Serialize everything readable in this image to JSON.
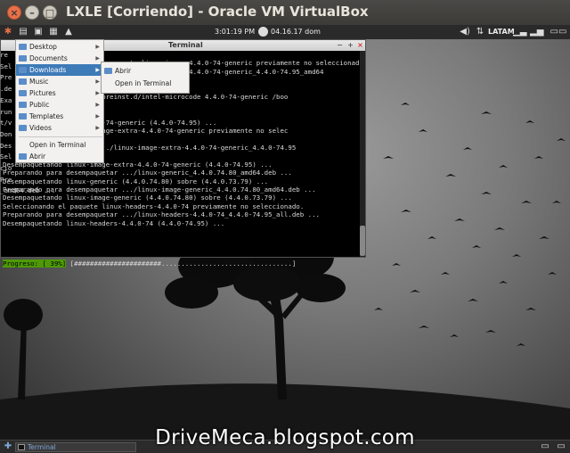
{
  "host_window": {
    "title": "LXLE [Corriendo] - Oracle VM VirtualBox",
    "controls": [
      "×",
      "–",
      "□"
    ]
  },
  "top_panel": {
    "clock": "3:01:19 PM",
    "date": "04.16.17 dom",
    "keyboard_layout": "LATAM",
    "icons": [
      "menu-icon",
      "files-icon",
      "monitor-icon",
      "apps-icon",
      "up-arrow-icon",
      "volume-icon",
      "network-icon",
      "updates-icon",
      "signal-icon",
      "power-icon"
    ]
  },
  "terminal": {
    "title": "Terminal",
    "controls": [
      "−",
      "+",
      "×"
    ],
    "left_glyphs": [
      "re",
      "Sel",
      "Pre",
      ".de",
      "Exa",
      "run",
      "t/v",
      "Don",
      "Des",
      "Sel",
      "cio",
      "Pre",
      "_amd64.deb ..."
    ],
    "lines": [
      "               04.1) ...",
      "          Seleccionando el paquete linux-image-4.4.0-74-generic previamente no seleccionad",
      "               a desempaquetar .../linux-image-4.4.0-74-generic_4.4.0-74.95_amd64",
      "",
      "               reinst.d/",
      "               tc/kernel/preinst.d/intel-microcode 4.4.0-74-generic /boo",
      "               ric",
      "",
      "               mage-4.4.0-74-generic (4.4.0-74.95) ...",
      "               e linux-image-extra-4.4.0-74-generic previamente no selec",
      "",
      "               paquetar .../linux-image-extra-4.4.0-74-generic_4.4.0-74.95",
      "",
      "Desempaquetando linux-image-extra-4.4.0-74-generic (4.4.0-74.95) ...",
      "Preparando para desempaquetar .../linux-generic_4.4.0.74.80_amd64.deb ...",
      "Desempaquetando linux-generic (4.4.0.74.80) sobre (4.4.0.73.79) ...",
      "Preparando para desempaquetar .../linux-image-generic_4.4.0.74.80_amd64.deb ...",
      "Desempaquetando linux-image-generic (4.4.0.74.80) sobre (4.4.0.73.79) ...",
      "Seleccionando el paquete linux-headers-4.4.0-74 previamente no seleccionado.",
      "Preparando para desempaquetar .../linux-headers-4.4.0-74_4.4.0-74.95_all.deb ...",
      "Desempaquetando linux-headers-4.4.0-74 (4.4.0-74.95) ..."
    ],
    "progress_label": "Progreso: [ 39%]",
    "progress_bar": " [######################.................................]",
    "progress_percent": 39
  },
  "places_menu": {
    "items": [
      {
        "label": "Desktop",
        "has_submenu": true
      },
      {
        "label": "Documents",
        "has_submenu": true
      },
      {
        "label": "Downloads",
        "has_submenu": true,
        "highlighted": true
      },
      {
        "label": "Music",
        "has_submenu": true
      },
      {
        "label": "Pictures",
        "has_submenu": true
      },
      {
        "label": "Public",
        "has_submenu": true
      },
      {
        "label": "Templates",
        "has_submenu": true
      },
      {
        "label": "Videos",
        "has_submenu": true
      }
    ],
    "open_in_terminal": "Open in Terminal",
    "open": "Abrir"
  },
  "sub_menu": {
    "open": "Abrir",
    "open_in_terminal": "Open in Terminal"
  },
  "bottom_panel": {
    "task_label": "Terminal"
  },
  "watermark": "DriveMeca.blogspot.com",
  "colors": {
    "menu_highlight": "#3d7ab8",
    "progress_green": "#4e9a06",
    "close_orange": "#e8704a"
  }
}
